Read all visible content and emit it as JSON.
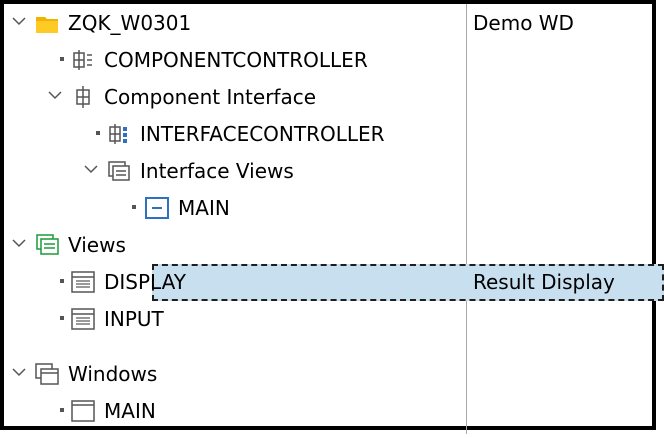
{
  "tree": {
    "rows": [
      {
        "label": "ZQK_W0301",
        "desc": "Demo WD"
      },
      {
        "label": "COMPONENTCONTROLLER",
        "desc": ""
      },
      {
        "label": "Component Interface",
        "desc": ""
      },
      {
        "label": "INTERFACECONTROLLER",
        "desc": ""
      },
      {
        "label": "Interface Views",
        "desc": ""
      },
      {
        "label": "MAIN",
        "desc": ""
      },
      {
        "label": "Views",
        "desc": ""
      },
      {
        "label": "DISPLAY",
        "desc": "Result Display"
      },
      {
        "label": "INPUT",
        "desc": ""
      },
      {
        "label": "Windows",
        "desc": ""
      },
      {
        "label": "MAIN",
        "desc": ""
      }
    ],
    "selected_row": "DISPLAY"
  },
  "colors": {
    "folder": "#f0b400",
    "selection_bg": "#c8dff0",
    "views_icon": "#1a9a3a",
    "interface_icon": "#3070c0"
  }
}
